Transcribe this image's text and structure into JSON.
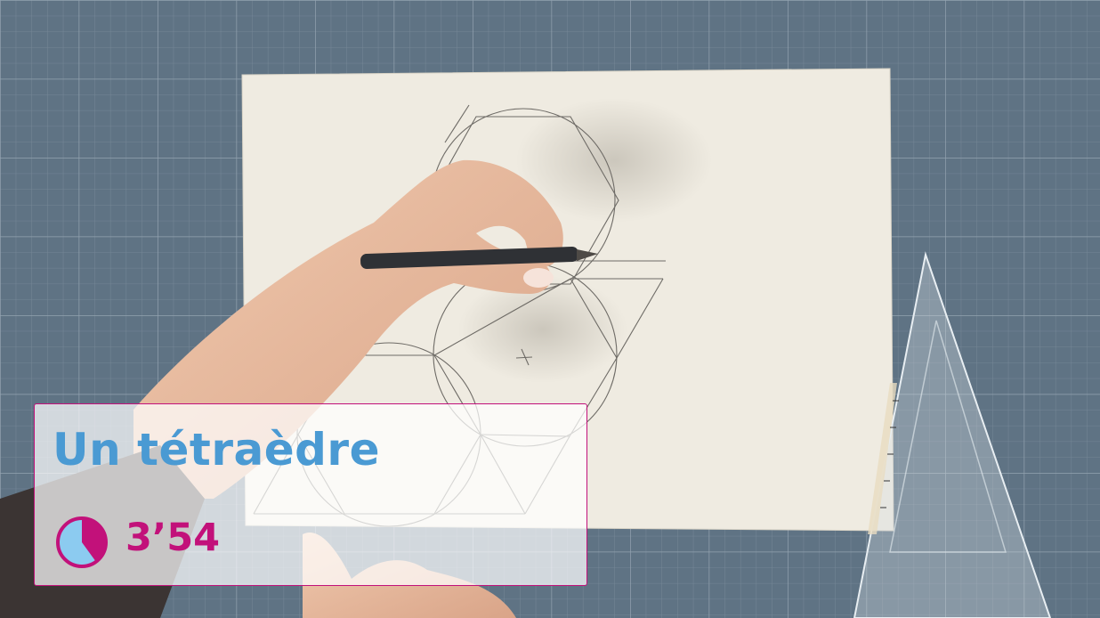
{
  "overlay": {
    "title": "Un tétraèdre",
    "duration": "3’54"
  },
  "icons": {
    "timer": "pie-clock-icon"
  },
  "colors": {
    "title": "#4a9ad3",
    "accent": "#c2117a",
    "timer_fill": "#8ccbf0",
    "grid_mat": "#5f7384",
    "paper": "#f1ede3"
  }
}
